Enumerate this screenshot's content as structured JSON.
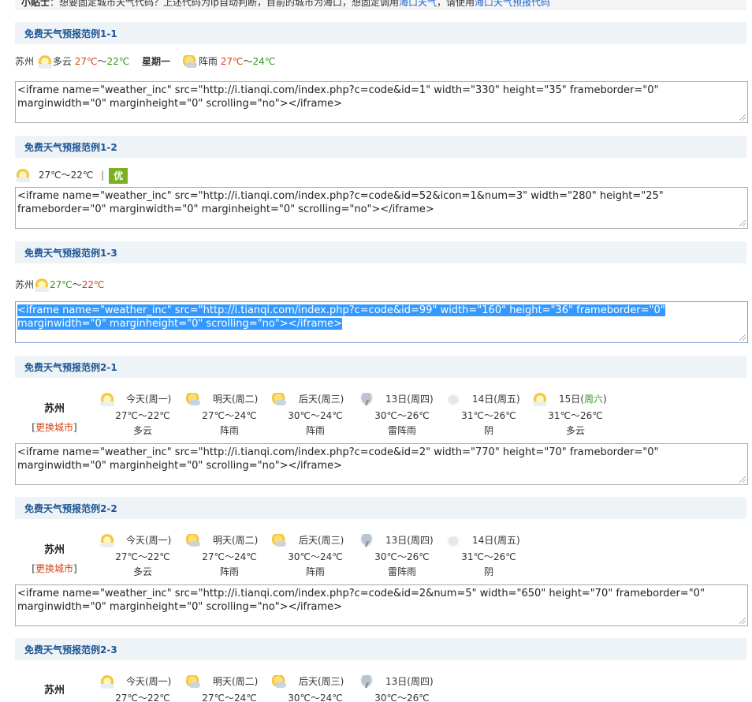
{
  "tip": {
    "label": "小贴士",
    "text": "：想要固定城市天气代码？上述代码为ip自动判断，目前的城市为海口，想固定调用",
    "link1": "海口天气",
    "mid": "，请使用",
    "link2": "海口天气预报代码"
  },
  "sections": [
    {
      "title": "免费天气预报范例1-1"
    },
    {
      "title": "免费天气预报范例1-2"
    },
    {
      "title": "免费天气预报范例1-3"
    },
    {
      "title": "免费天气预报范例2-1"
    },
    {
      "title": "免费天气预报范例2-2"
    },
    {
      "title": "免费天气预报范例2-3"
    }
  ],
  "ex11": {
    "city": "苏州",
    "cond1": "多云",
    "high1": "27℃",
    "tilde": "～",
    "low1": "22℃",
    "weekday": "星期一",
    "cond2": "阵雨",
    "high2": "27℃",
    "low2": "24℃"
  },
  "ex12": {
    "temp": "27℃～22℃",
    "sep": "|",
    "aqi": "优"
  },
  "ex13": {
    "city": "苏州",
    "high": "27℃",
    "tilde": "～",
    "low": "22℃"
  },
  "codes": [
    "<iframe name=\"weather_inc\" src=\"http://i.tianqi.com/index.php?c=code&id=1\" width=\"330\" height=\"35\" frameborder=\"0\" marginwidth=\"0\" marginheight=\"0\" scrolling=\"no\"></iframe>",
    "<iframe name=\"weather_inc\" src=\"http://i.tianqi.com/index.php?c=code&id=52&icon=1&num=3\" width=\"280\" height=\"25\" frameborder=\"0\" marginwidth=\"0\" marginheight=\"0\" scrolling=\"no\"></iframe>",
    "<iframe name=\"weather_inc\" src=\"http://i.tianqi.com/index.php?c=code&id=99\" width=\"160\" height=\"36\" frameborder=\"0\" marginwidth=\"0\" marginheight=\"0\" scrolling=\"no\"></iframe>",
    "<iframe name=\"weather_inc\" src=\"http://i.tianqi.com/index.php?c=code&id=2\" width=\"770\" height=\"70\" frameborder=\"0\" marginwidth=\"0\" marginheight=\"0\" scrolling=\"no\"></iframe>",
    "<iframe name=\"weather_inc\" src=\"http://i.tianqi.com/index.php?c=code&id=2&num=5\" width=\"650\" height=\"70\" frameborder=\"0\" marginwidth=\"0\" marginheight=\"0\" scrolling=\"no\"></iframe>"
  ],
  "forecast": {
    "city": "苏州",
    "change_open": "[",
    "change_label": "更换城市",
    "change_close": "]",
    "days": [
      {
        "label": "今天(周一)",
        "temp": "27℃～22℃",
        "cond": "多云",
        "icon": "sun"
      },
      {
        "label": "明天(周二)",
        "temp": "27℃～24℃",
        "cond": "阵雨",
        "icon": "rainy"
      },
      {
        "label": "后天(周三)",
        "temp": "30℃～24℃",
        "cond": "阵雨",
        "icon": "rainy"
      },
      {
        "label": "13日(周四)",
        "temp": "30℃～26℃",
        "cond": "雷阵雨",
        "icon": "storm"
      },
      {
        "label": "14日(周五)",
        "temp": "31℃～26℃",
        "cond": "阴",
        "icon": "cloud"
      },
      {
        "label_pre": "15日(",
        "label_hl": "周六",
        "label_post": ")",
        "temp": "31℃～26℃",
        "cond": "多云",
        "icon": "sun"
      }
    ]
  },
  "colors": {
    "high": "#d4441a",
    "low": "#2f9a1f",
    "section_title": "#1d5693",
    "section_bg": "#eef3f8",
    "aqi": "#7bb022",
    "selection": "#3399ff"
  }
}
